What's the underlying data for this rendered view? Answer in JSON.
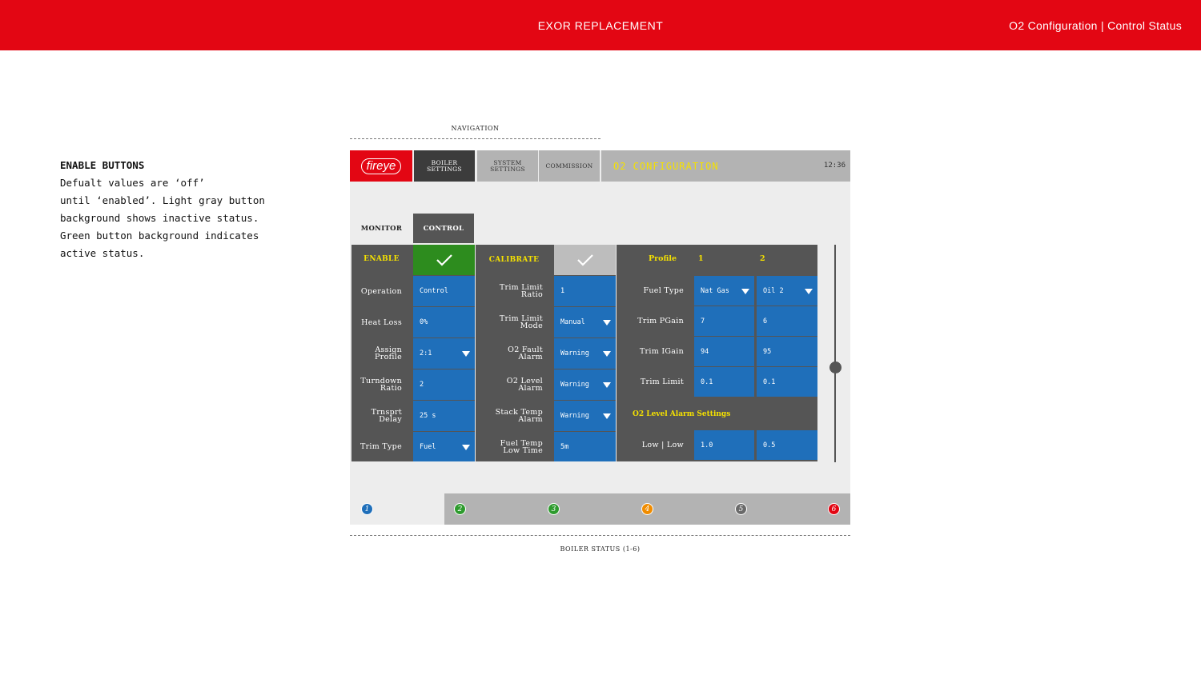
{
  "header": {
    "title": "EXOR REPLACEMENT",
    "subtitle": "O2 Configuration | Control Status"
  },
  "note": {
    "heading": "ENABLE BUTTONS",
    "lines": [
      "Defualt values are ‘off’",
      "until ‘enabled’. Light gray button",
      "background shows inactive status.",
      "Green button background indicates",
      "active status."
    ]
  },
  "navigation_label": "NAVIGATION",
  "boiler_status_label": "BOILER STATUS (1-6)",
  "nav": {
    "logo": "fireye",
    "boiler_settings": [
      "BOILER",
      "SETTINGS"
    ],
    "system_settings": [
      "SYSTEM",
      "SETTINGS"
    ],
    "commission": "COMMISSION",
    "screen_title": "O2 CONFIGURATION",
    "clock": "12:36"
  },
  "tabs": {
    "monitor": "MONITOR",
    "control": "CONTROL"
  },
  "left_panel": {
    "enable_label": "ENABLE",
    "enable_active": true,
    "rows": [
      {
        "label": [
          "Operation"
        ],
        "value": "Control",
        "dropdown": false
      },
      {
        "label": [
          "Heat Loss"
        ],
        "value": "0%",
        "dropdown": false
      },
      {
        "label": [
          "Assign",
          "Profile"
        ],
        "value": "2:1",
        "dropdown": true
      },
      {
        "label": [
          "Turndown",
          "Ratio"
        ],
        "value": "2",
        "dropdown": false
      },
      {
        "label": [
          "Trnsprt",
          "Delay"
        ],
        "value": "25 s",
        "dropdown": false
      },
      {
        "label": [
          "Trim Type"
        ],
        "value": "Fuel",
        "dropdown": true
      }
    ]
  },
  "middle_panel": {
    "calibrate_label": "CALIBRATE",
    "calibrate_active": false,
    "rows": [
      {
        "label": [
          "Trim Limit",
          "Ratio"
        ],
        "value": "1",
        "dropdown": false
      },
      {
        "label": [
          "Trim Limit",
          "Mode"
        ],
        "value": "Manual",
        "dropdown": true
      },
      {
        "label": [
          "O2 Fault",
          "Alarm"
        ],
        "value": "Warning",
        "dropdown": true
      },
      {
        "label": [
          "O2 Level",
          "Alarm"
        ],
        "value": "Warning",
        "dropdown": true
      },
      {
        "label": [
          "Stack Temp",
          "Alarm"
        ],
        "value": "Warning",
        "dropdown": true
      },
      {
        "label": [
          "Fuel Temp",
          "Low Time"
        ],
        "value": "5m",
        "dropdown": false
      }
    ]
  },
  "right_panel": {
    "profile_label": "Profile",
    "profile_1": "1",
    "profile_2": "2",
    "rows": [
      {
        "label": "Fuel Type",
        "v1": "Nat Gas",
        "v2": "Oil 2",
        "dropdown": true
      },
      {
        "label": "Trim PGain",
        "v1": "7",
        "v2": "6",
        "dropdown": false
      },
      {
        "label": "Trim IGain",
        "v1": "94",
        "v2": "95",
        "dropdown": false
      },
      {
        "label": "Trim Limit",
        "v1": "0.1",
        "v2": "0.1",
        "dropdown": false
      }
    ],
    "alarm_settings_label": "O2 Level Alarm Settings",
    "alarm_row": {
      "label": "Low | Low",
      "v1": "1.0",
      "v2": "0.5"
    }
  },
  "boiler_status": [
    {
      "num": "1",
      "color": "#1f6fba"
    },
    {
      "num": "2",
      "color": "#2e9b2e"
    },
    {
      "num": "3",
      "color": "#2e9b2e"
    },
    {
      "num": "4",
      "color": "#f08c00"
    },
    {
      "num": "5",
      "color": "#6a6a6a"
    },
    {
      "num": "6",
      "color": "#e30613"
    }
  ]
}
